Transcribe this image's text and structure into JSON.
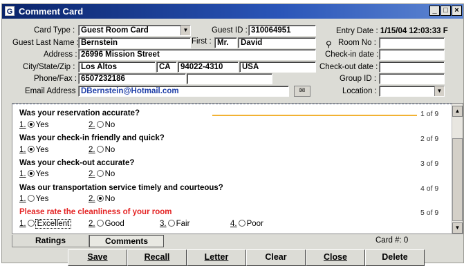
{
  "window": {
    "title": "Comment Card",
    "app_icon": "G",
    "minimize": "_",
    "maximize": "□",
    "close": "×"
  },
  "form": {
    "card_type_label": "Card Type :",
    "card_type_value": "Guest Room Card",
    "guest_id_label": "Guest ID :",
    "guest_id_value": "310064951",
    "entry_date_label": "Entry Date :",
    "entry_date_value": "1/15/04 12:03:33 F",
    "guest_last_name_label": "Guest Last Name :",
    "guest_last_name_value": "Bernstein",
    "first_label": "First :",
    "title_value": "Mr.",
    "first_value": "David",
    "room_no_label": "Room No :",
    "address_label": "Address :",
    "address_value": "26996 Mission Street",
    "checkin_label": "Check-in date :",
    "city_state_zip_label": "City/State/Zip :",
    "city_value": "Los Altos",
    "state_value": "CA",
    "zip_value": "94022-4310",
    "country_value": "USA",
    "checkout_label": "Check-out date :",
    "phone_fax_label": "Phone/Fax :",
    "phone_value": "6507232186",
    "group_id_label": "Group ID :",
    "email_label": "Email Address :",
    "email_value": "DBernstein@Hotmail.com",
    "location_label": "Location :"
  },
  "survey": {
    "questions": [
      {
        "text": "Was your reservation accurate?",
        "num": "1 of 9",
        "options": [
          "1.",
          "Yes",
          "2.",
          "No"
        ],
        "selected": 1
      },
      {
        "text": "Was your check-in friendly and quick?",
        "num": "2 of 9",
        "options": [
          "1.",
          "Yes",
          "2.",
          "No"
        ],
        "selected": 1
      },
      {
        "text": "Was your check-out accurate?",
        "num": "3 of 9",
        "options": [
          "1.",
          "Yes",
          "2.",
          "No"
        ],
        "selected": 1
      },
      {
        "text": "Was our transportation service timely and courteous?",
        "num": "4 of 9",
        "options": [
          "1.",
          "Yes",
          "2.",
          "No"
        ],
        "selected": 2
      },
      {
        "text": "Please rate the cleanliness of your room",
        "num": "5 of 9",
        "options": [
          "1.",
          "Excellent",
          "2.",
          "Good",
          "3.",
          "Fair",
          "4.",
          "Poor"
        ],
        "selected": 0
      }
    ]
  },
  "tabs": {
    "ratings": "Ratings",
    "comments": "Comments"
  },
  "card_number": "Card #: 0",
  "buttons": {
    "save": "Save",
    "recall": "Recall",
    "letter": "Letter",
    "clear": "Clear",
    "close": "Close",
    "delete": "Delete"
  },
  "colors": {
    "title_bar": "#0a246a",
    "highlight_question": "#e42424",
    "email_text": "#1f3fa8",
    "accent_line": "#f2b233"
  },
  "icons": {
    "room_lookup": "key-icon",
    "email_send": "envelope-icon"
  }
}
